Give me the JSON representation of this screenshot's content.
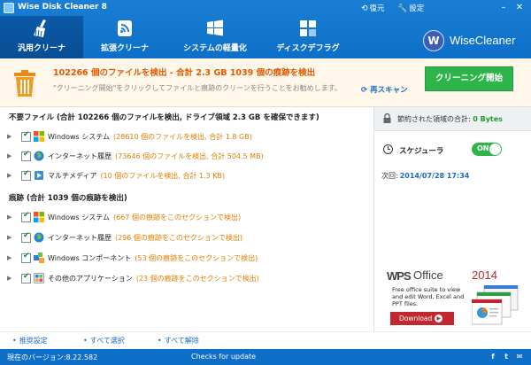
{
  "window": {
    "title": "Wise Disk Cleaner 8",
    "restore_label": "復元",
    "settings_label": "設定",
    "minimize_symbol": "–",
    "close_symbol": "✕"
  },
  "tabs": [
    {
      "label": "汎用クリーナ",
      "icon": "broom-icon",
      "active": true
    },
    {
      "label": "拡張クリーナ",
      "icon": "advanced-clean-icon",
      "active": false
    },
    {
      "label": "システムの軽量化",
      "icon": "windows-icon",
      "active": false
    },
    {
      "label": "ディスクデフラグ",
      "icon": "defrag-icon",
      "active": false
    }
  ],
  "brand": {
    "logo_letter": "W",
    "name": "WiseCleaner"
  },
  "summary": {
    "title": "102266 個のファイルを検出 - 合計 2.3 GB 1039 個の痕跡を検出",
    "description": "\"クリーニング開始\"をクリックしてファイルと痕跡のクリーンを行うことをお勧めします。",
    "clean_button": "クリーニング開始",
    "rescan": "再スキャン"
  },
  "junk_section": {
    "header": "不要ファイル (合計 102266 個のファイルを検出, ドライブ領域 2.3 GB を確保できます)",
    "items": [
      {
        "label": "Windows システム",
        "detail": "(28610 個のファイルを検出, 合計 1.8 GB)",
        "icon": "windows-icon",
        "checked": true
      },
      {
        "label": "インターネット履歴",
        "detail": "(73646 個のファイルを検出, 合計 504.5 MB)",
        "icon": "globe-icon",
        "checked": true
      },
      {
        "label": "マルチメディア",
        "detail": "(10 個のファイルを検出, 合計 1.3 KB)",
        "icon": "multimedia-icon",
        "checked": true
      }
    ]
  },
  "traces_section": {
    "header": "痕跡 (合計 1039 個の痕跡を検出)",
    "items": [
      {
        "label": "Windows システム",
        "detail": "(667 個の痕跡をこのセクションで検出)",
        "icon": "windows-icon",
        "checked": true
      },
      {
        "label": "インターネット履歴",
        "detail": "(296 個の痕跡をこのセクションで検出)",
        "icon": "globe-icon",
        "checked": true
      },
      {
        "label": "Windows コンポーネント",
        "detail": "(53 個の痕跡をこのセクションで検出)",
        "icon": "component-icon",
        "checked": true
      },
      {
        "label": "その他のアプリケーション",
        "detail": "(23 個の痕跡をこのセクションで検出)",
        "icon": "apps-icon",
        "checked": true
      }
    ]
  },
  "side": {
    "saved_label": "節約された領域の合計:",
    "saved_value": "0 Bytes",
    "scheduler_label": "スケジューラ",
    "toggle_label": "ON",
    "next_label": "次回:",
    "next_value": "2014/07/28 17:34"
  },
  "ad": {
    "logo_mark": "WPS",
    "brand": "Office",
    "year": "2014",
    "description": "Free office suite to view and edit Word, Excel and PPT files.",
    "download": "Download"
  },
  "bottom_links": [
    "推奨設定",
    "すべて選択",
    "すべて解除"
  ],
  "statusbar": {
    "version": "現在のバージョン:8.22.582",
    "update": "Checks for update",
    "social": [
      "f",
      "t",
      "✉"
    ]
  },
  "colors": {
    "header_blue": "#0d6fc7",
    "accent_orange": "#e05a00",
    "clean_green": "#2db54a",
    "detail_orange": "#e07f00",
    "link_blue": "#1a6bc5",
    "wps_red": "#c1272d"
  }
}
